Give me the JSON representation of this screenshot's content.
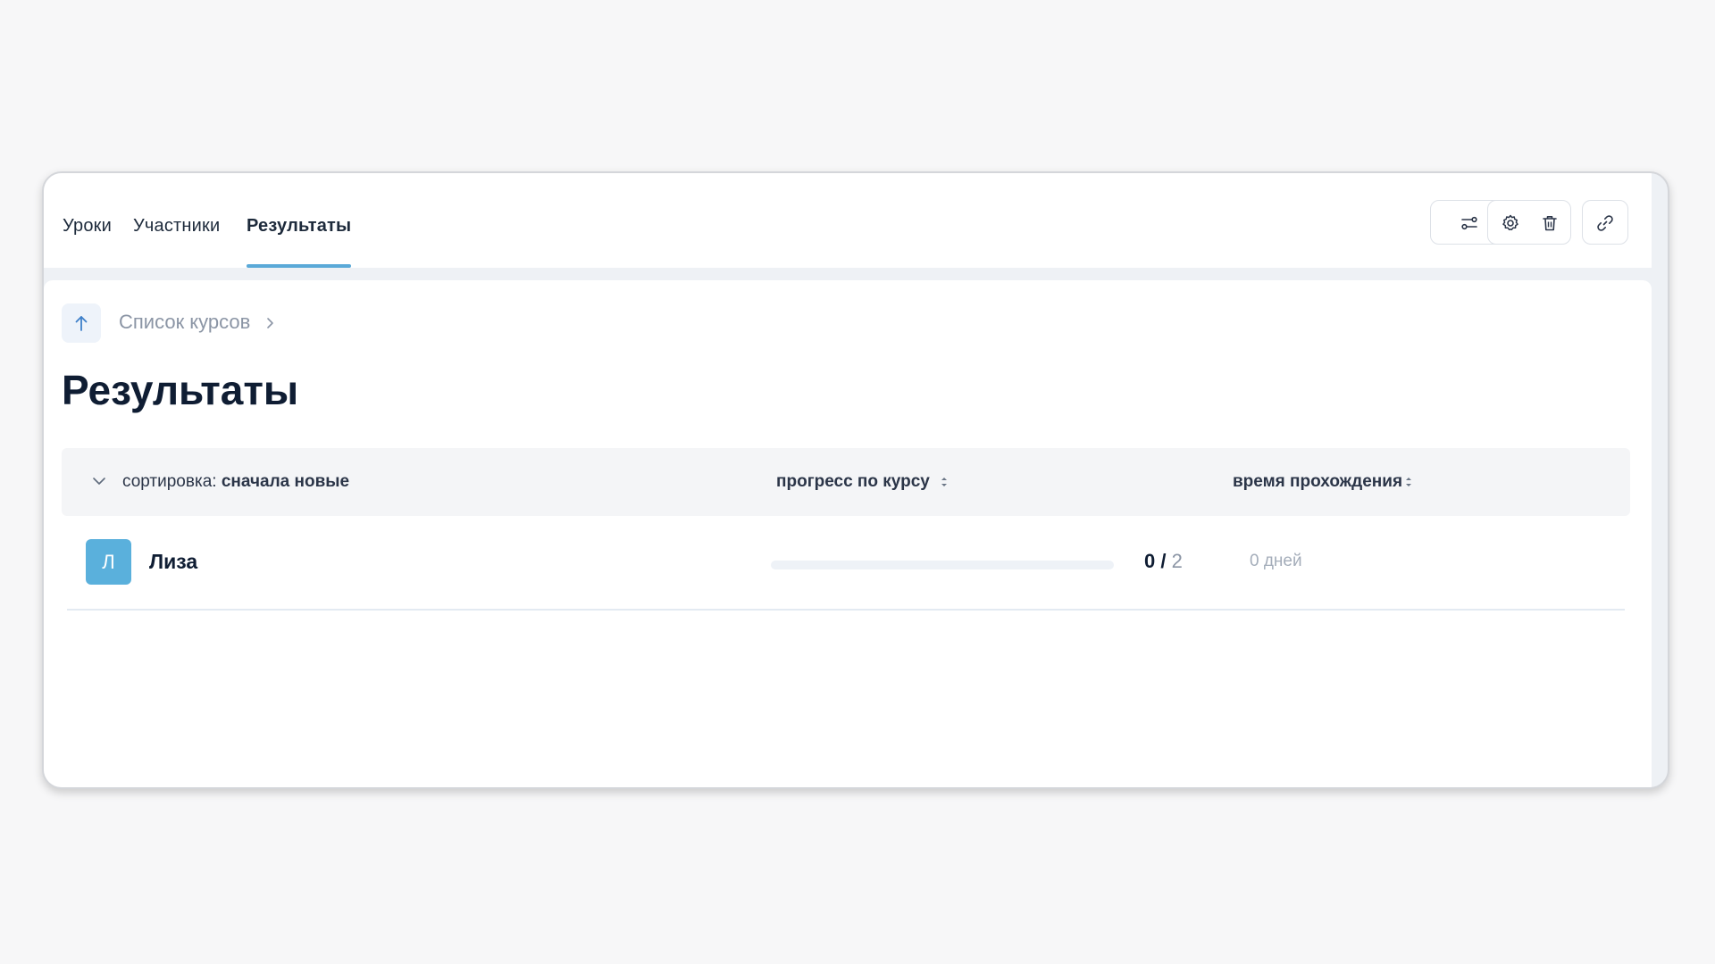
{
  "tabs": [
    {
      "label": "Уроки",
      "active": false
    },
    {
      "label": "Участники",
      "active": false
    },
    {
      "label": "Результаты",
      "active": true
    }
  ],
  "toolbar": {
    "icons": [
      "filter-settings-icon",
      "gear-icon",
      "trash-icon",
      "link-icon"
    ]
  },
  "breadcrumb": {
    "back_icon": "arrow-up-icon",
    "label": "Список курсов"
  },
  "page": {
    "title": "Результаты"
  },
  "table": {
    "sort_prefix": "сортировка:",
    "sort_value": "сначала новые",
    "columns": {
      "progress": "прогресс по курсу",
      "time": "время прохождения"
    },
    "rows": [
      {
        "avatar_letter": "Л",
        "name": "Лиза",
        "progress_done": "0",
        "progress_sep": " / ",
        "progress_total": "2",
        "progress_fraction": 0,
        "time": "0 дней"
      }
    ]
  },
  "colors": {
    "accent": "#5aa9d8",
    "avatar": "#5ab0dc",
    "title": "#0f1d33",
    "muted": "#8b95a5"
  }
}
